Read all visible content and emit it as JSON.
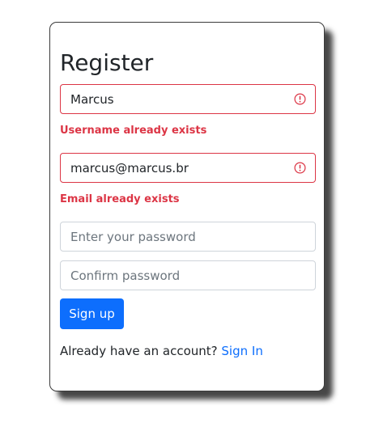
{
  "form": {
    "title": "Register",
    "username": {
      "value": "Marcus",
      "error": "Username already exists"
    },
    "email": {
      "value": "marcus@marcus.br",
      "error": "Email already exists"
    },
    "password": {
      "placeholder": "Enter your password",
      "value": ""
    },
    "confirm": {
      "placeholder": "Confirm password",
      "value": ""
    },
    "submit_label": "Sign up",
    "footer_text": "Already have an account?",
    "signin_link": "Sign In"
  },
  "icons": {
    "warning": "exclamation-circle-icon"
  },
  "colors": {
    "error": "#dc3545",
    "primary": "#0d6efd",
    "input_border": "#ced4da"
  }
}
